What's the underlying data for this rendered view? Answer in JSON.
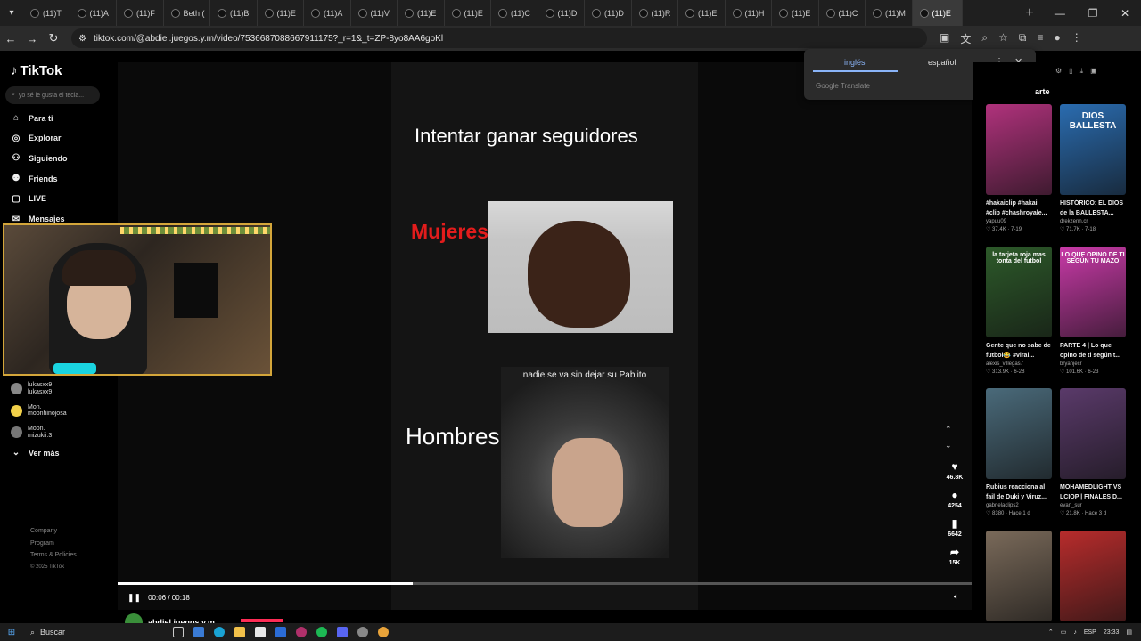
{
  "browser": {
    "tabs": [
      {
        "label": "(11)Ti"
      },
      {
        "label": "(11)A"
      },
      {
        "label": "(11)F"
      },
      {
        "label": "Beth ("
      },
      {
        "label": "(11)B"
      },
      {
        "label": "(11)E"
      },
      {
        "label": "(11)A"
      },
      {
        "label": "(11)V"
      },
      {
        "label": "(11)E"
      },
      {
        "label": "(11)E"
      },
      {
        "label": "(11)C"
      },
      {
        "label": "(11)D"
      },
      {
        "label": "(11)D"
      },
      {
        "label": "(11)R"
      },
      {
        "label": "(11)E"
      },
      {
        "label": "(11)H"
      },
      {
        "label": "(11)E"
      },
      {
        "label": "(11)C"
      },
      {
        "label": "(11)M"
      },
      {
        "label": "(11)E"
      }
    ],
    "url": "tiktok.com/@abdiel.juegos.y.m/video/7536687088667911175?_r=1&_t=ZP-8yo8AA6goKl"
  },
  "sidebar": {
    "logo": "TikTok",
    "search_placeholder": "yo sé le gusta el tecla...",
    "nav": [
      {
        "label": "Para ti",
        "icon": "home-icon"
      },
      {
        "label": "Explorar",
        "icon": "compass-icon"
      },
      {
        "label": "Siguiendo",
        "icon": "following-icon"
      },
      {
        "label": "Friends",
        "icon": "friends-icon"
      },
      {
        "label": "LIVE",
        "icon": "live-icon"
      },
      {
        "label": "Mensajes",
        "icon": "messages-icon"
      }
    ],
    "following": [
      {
        "name": "lukasxx9",
        "handle": "lukasxx9",
        "color": "#888888"
      },
      {
        "name": "Mon.",
        "handle": "moonhinojosa",
        "color": "#f2d14a"
      },
      {
        "name": "Moon.",
        "handle": "mizukii.3",
        "color": "#777777"
      }
    ],
    "see_more": "Ver más",
    "footer": [
      "Company",
      "Program",
      "Terms & Policies"
    ],
    "copyright": "© 2025 TikTok"
  },
  "video": {
    "title_text": "Intentar ganar seguidores",
    "label_women": "Mujeres",
    "label_men": "Hombres",
    "caption_croc": "nadie se va sin dejar su Pablito",
    "time_current": "00:06",
    "time_total": "00:18",
    "progress": 0.345,
    "author": "abdiel.juegos.y.m"
  },
  "actions": {
    "likes": "46.8K",
    "comments": "4254",
    "saves": "6642",
    "shares": "15K"
  },
  "translate": {
    "lang_from": "inglés",
    "lang_to": "español",
    "brand": "Google Translate"
  },
  "right_panel": {
    "title": "arte",
    "cards": [
      {
        "caption": "#hakaiclip #hakai #clip #chashroyale...",
        "author": "yapuu09",
        "stats": "♡ 37.4K · 7-19",
        "thumb_text": "",
        "bg": "#b0327c"
      },
      {
        "caption": "HISTÓRICO: EL DIOS de la BALLESTA...",
        "author": "drekzenn.cr",
        "stats": "♡ 71.7K · 7-18",
        "thumb_text": "DIOS BALLESTA",
        "bg": "#2a6cb0"
      },
      {
        "caption": "Gente que no sabe de futbol😂 #viral...",
        "author": "alexis_villegas7",
        "stats": "♡ 313.9K · 6-28",
        "thumb_text": "la tarjeta roja mas tonta del futbol",
        "bg": "#2d5a2a"
      },
      {
        "caption": "PARTE 4 | Lo que opino de ti según t...",
        "author": "bryanjecr",
        "stats": "♡ 101.6K · 6-23",
        "thumb_text": "LO QUE OPINO DE TI SEGÚN TU MAZO",
        "bg": "#c93aa8"
      },
      {
        "caption": "Rubius reacciona al fail de Duki y Viruz...",
        "author": "gabrielaclips2",
        "stats": "♡ 8380 · Hace 1 d",
        "thumb_text": "",
        "bg": "#4a6a7a"
      },
      {
        "caption": "MOHAMEDLIGHT VS LCIOP | FINALES D...",
        "author": "evan_sur",
        "stats": "♡ 21.8K · Hace 3 d",
        "thumb_text": "",
        "bg": "#5a3a6a"
      },
      {
        "caption": "",
        "author": "",
        "stats": "",
        "thumb_text": "",
        "bg": "#7a6a5a"
      },
      {
        "caption": "",
        "author": "",
        "stats": "",
        "thumb_text": "",
        "bg": "#b82c2c"
      }
    ]
  },
  "taskbar": {
    "search": "Buscar",
    "lang": "ESP",
    "time": "23:33"
  }
}
